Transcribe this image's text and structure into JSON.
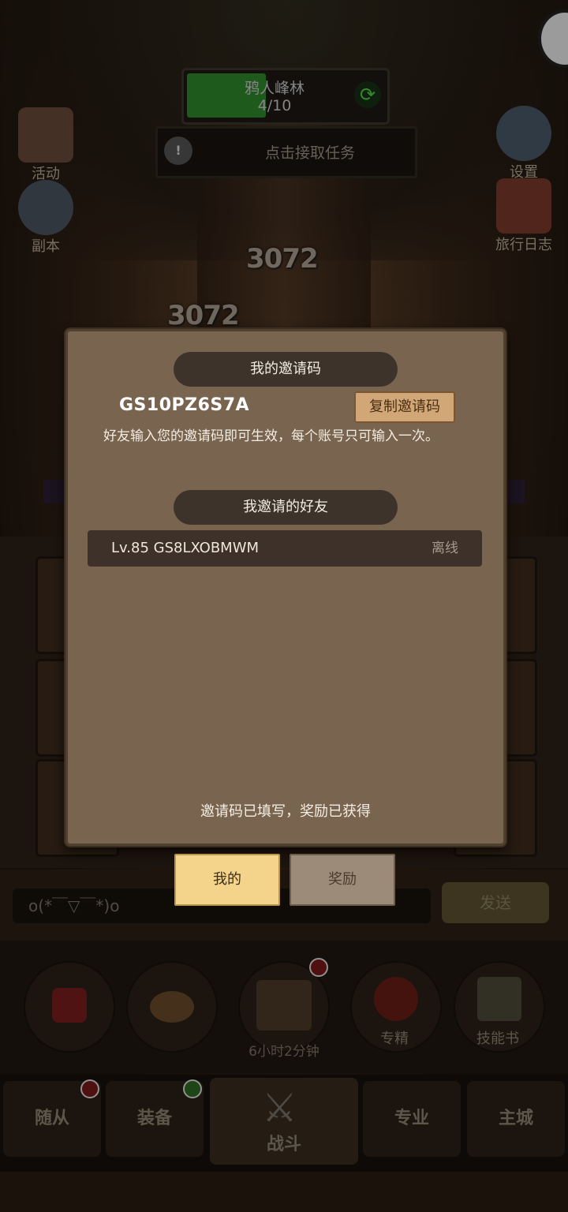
{
  "hud": {
    "zone_name": "鸦人峰林",
    "zone_progress_text": "4/10",
    "zone_progress": 0.4,
    "quest_prompt": "点击接取任务"
  },
  "side_buttons": {
    "left": [
      {
        "label": "活动",
        "icon": "event-icon"
      },
      {
        "label": "副本",
        "icon": "dungeon-icon"
      }
    ],
    "right": [
      {
        "label": "设置",
        "icon": "gear-icon"
      },
      {
        "label": "旅行日志",
        "icon": "journal-icon"
      }
    ]
  },
  "damage_numbers": [
    "3072",
    "3072"
  ],
  "modal": {
    "my_code_title": "我的邀请码",
    "invite_code": "GS10PZ6S7A",
    "copy_button": "复制邀请码",
    "hint": "好友输入您的邀请码即可生效，每个账号只可输入一次。",
    "friends_title": "我邀请的好友",
    "friends": [
      {
        "name": "Lv.85 GS8LXOBMWM",
        "status": "离线"
      }
    ],
    "status_line": "邀请码已填写，奖励已获得"
  },
  "tabs": {
    "mine": "我的",
    "reward": "奖励"
  },
  "chat": {
    "input_value": "o(*￣▽￣*)o",
    "send_label": "发送"
  },
  "skills": {
    "specialize": "专精",
    "skill_book": "技能书",
    "timer": "6小时2分钟"
  },
  "nav": {
    "follower": "随从",
    "equipment": "装备",
    "battle": "战斗",
    "profession": "专业",
    "main_city": "主城"
  },
  "colors": {
    "modal_bg": "#79654f",
    "pill_bg": "#3e332a",
    "tab_active": "#f4d48a",
    "progress": "#2f8a2a"
  }
}
